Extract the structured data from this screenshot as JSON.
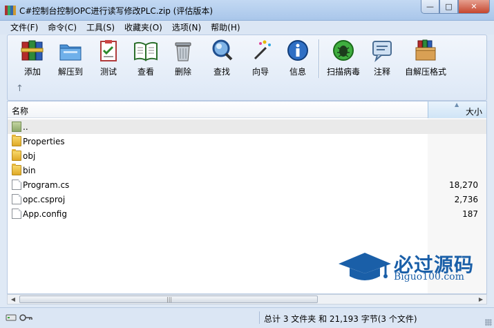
{
  "window": {
    "title": "C#控制台控制OPC进行读写修改PLC.zip (评估版本)",
    "minimize_glyph": "—",
    "maximize_glyph": "□",
    "close_glyph": "✕"
  },
  "menu": [
    "文件(F)",
    "命令(C)",
    "工具(S)",
    "收藏夹(O)",
    "选项(N)",
    "帮助(H)"
  ],
  "toolbar": {
    "buttons": [
      {
        "label": "添加",
        "icon": "books-icon"
      },
      {
        "label": "解压到",
        "icon": "folder-extract-icon"
      },
      {
        "label": "测试",
        "icon": "clipboard-check-icon"
      },
      {
        "label": "查看",
        "icon": "open-book-icon"
      },
      {
        "label": "删除",
        "icon": "trash-can-icon"
      },
      {
        "label": "查找",
        "icon": "magnifier-icon"
      },
      {
        "label": "向导",
        "icon": "magic-wand-icon"
      },
      {
        "label": "信息",
        "icon": "info-icon"
      },
      {
        "label": "扫描病毒",
        "icon": "bug-shield-icon"
      },
      {
        "label": "注释",
        "icon": "comment-icon"
      },
      {
        "label": "自解压格式",
        "icon": "sfx-box-icon"
      }
    ],
    "up_glyph": "↑"
  },
  "file_list": {
    "columns": {
      "name": "名称",
      "size": "大小"
    },
    "rows": [
      {
        "name": "..",
        "size": "",
        "type": "updir"
      },
      {
        "name": "Properties",
        "size": "",
        "type": "folder"
      },
      {
        "name": "obj",
        "size": "",
        "type": "folder"
      },
      {
        "name": "bin",
        "size": "",
        "type": "folder"
      },
      {
        "name": "Program.cs",
        "size": "18,270",
        "type": "file"
      },
      {
        "name": "opc.csproj",
        "size": "2,736",
        "type": "file"
      },
      {
        "name": "App.config",
        "size": "187",
        "type": "file"
      }
    ]
  },
  "watermark": {
    "cn": "必过源码",
    "en": "Biguo100.com"
  },
  "status": {
    "text": "总计 3 文件夹 和 21,193 字节(3 个文件)"
  },
  "colors": {
    "accent": "#1a5fa8",
    "title_bar": "#b8d0ee",
    "close": "#c5462e"
  }
}
